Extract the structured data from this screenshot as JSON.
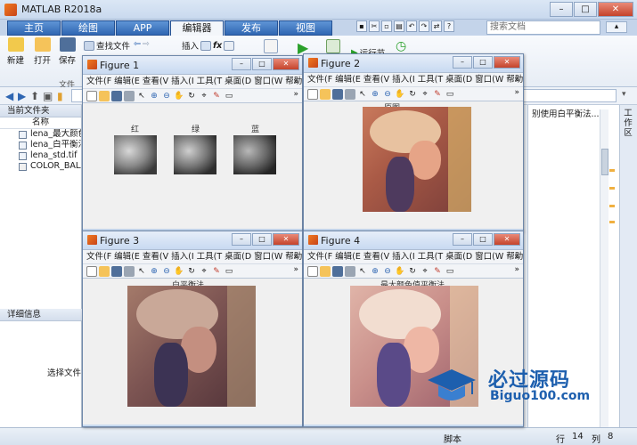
{
  "window": {
    "title": "MATLAB R2018a",
    "min": "–",
    "max": "□",
    "close": "✕"
  },
  "ribbon_tabs": [
    "主页",
    "绘图",
    "APP",
    "编辑器",
    "发布",
    "视图"
  ],
  "search": {
    "placeholder": "搜索文档"
  },
  "ribbon": {
    "new": "新建",
    "open": "打开",
    "save": "保存",
    "find_files": "查找文件",
    "insert": "插入",
    "fx": "fx",
    "run_section": "运行节",
    "file_group": "文件"
  },
  "left_panel": {
    "header": "当前文件夹",
    "column": "名称",
    "files": [
      "lena_最大颜色平",
      "lena_白平衡法.m",
      "lena_std.tif",
      "COLOR_BALAN"
    ],
    "details_header": "详细信息",
    "details_empty": "选择文件以"
  },
  "editor_partial": "别使用白平衡法...",
  "right_dock": "工作区",
  "status": {
    "script": "脚本",
    "row_label": "行",
    "row": "14",
    "col_label": "列",
    "col": "8"
  },
  "figure_menu": [
    "文件(F",
    "编辑(E",
    "查看(V",
    "插入(I",
    "工具(T",
    "桌面(D",
    "窗口(W",
    "帮助(H"
  ],
  "figures": [
    {
      "title": "Figure 1",
      "axes_titles": [
        "红",
        "绿",
        "蓝"
      ]
    },
    {
      "title": "Figure 2",
      "axes_titles": [
        "原图"
      ]
    },
    {
      "title": "Figure 3",
      "axes_titles": [
        "白平衡法"
      ]
    },
    {
      "title": "Figure 4",
      "axes_titles": [
        "最大颜色值平衡法"
      ]
    }
  ],
  "watermark": {
    "title": "必过源码",
    "subtitle": "Biguo100.com"
  }
}
